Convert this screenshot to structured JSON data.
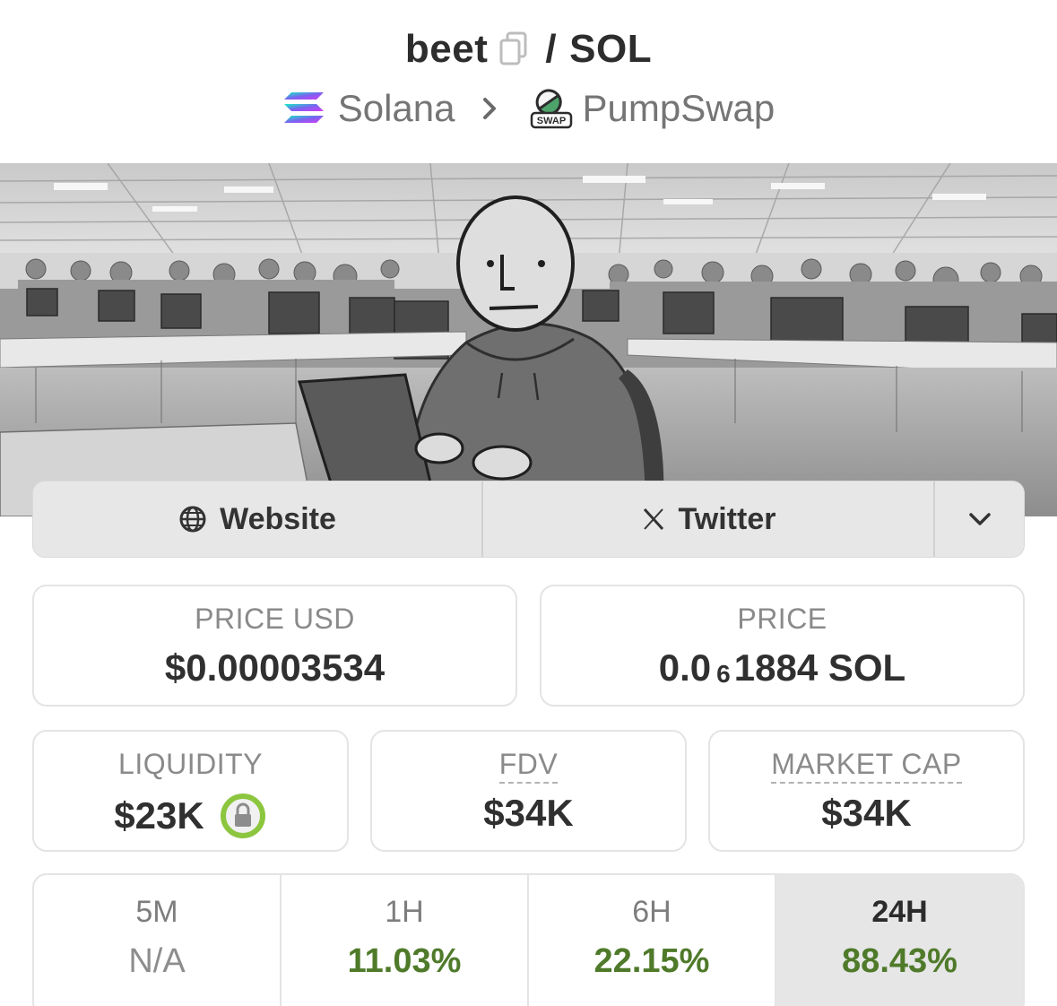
{
  "header": {
    "token": "beet",
    "slash": "/",
    "quote": "SOL",
    "chain": "Solana",
    "dex": "PumpSwap",
    "dex_logo_text": "SWAP"
  },
  "links": {
    "website": "Website",
    "twitter": "Twitter"
  },
  "stats": {
    "price_usd_label": "PRICE USD",
    "price_usd_value": "$0.00003534",
    "price_label": "PRICE",
    "price_prefix": "0.0",
    "price_zeros": "6",
    "price_suffix": "1884 SOL",
    "liquidity_label": "LIQUIDITY",
    "liquidity_value": "$23K",
    "fdv_label": "FDV",
    "fdv_value": "$34K",
    "mcap_label": "MARKET CAP",
    "mcap_value": "$34K"
  },
  "timeframes": [
    {
      "label": "5M",
      "value": "N/A"
    },
    {
      "label": "1H",
      "value": "11.03%"
    },
    {
      "label": "6H",
      "value": "22.15%"
    },
    {
      "label": "24H",
      "value": "88.43%"
    }
  ],
  "colors": {
    "positive": "#4f7a2a",
    "lock_ring": "#8cc63f"
  }
}
